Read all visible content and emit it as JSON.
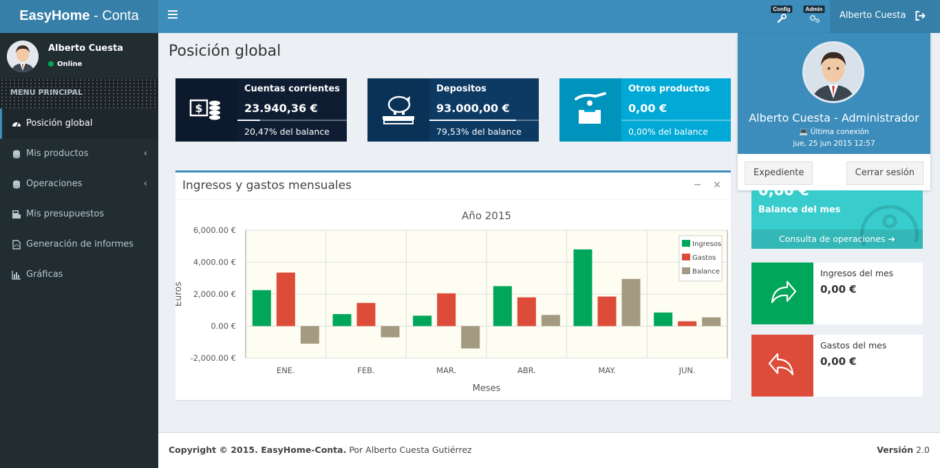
{
  "header": {
    "logo_bold": "EasyHome",
    "logo_rest": " - Conta",
    "config_label": "Config",
    "admin_label": "Admin",
    "user_name": "Alberto Cuesta"
  },
  "sidebar": {
    "user_name": "Alberto Cuesta",
    "status": "Online",
    "menu_header": "MENU PRINCIPAL",
    "items": [
      {
        "label": "Posición global",
        "icon": "dashboard-icon"
      },
      {
        "label": "Mis productos",
        "icon": "coins-icon"
      },
      {
        "label": "Operaciones",
        "icon": "coins-icon"
      },
      {
        "label": "Mis presupuestos",
        "icon": "calculator-icon"
      },
      {
        "label": "Generación de informes",
        "icon": "file-pdf-icon"
      },
      {
        "label": "Gráficas",
        "icon": "bar-chart-icon"
      }
    ]
  },
  "main": {
    "title": "Posición global",
    "info_boxes": [
      {
        "title": "Cuentas corrientes",
        "value": "23.940,36 €",
        "desc": "20,47% del balance",
        "progress": 0.2047,
        "color": "#0f1d33",
        "icon": "money-coins-icon"
      },
      {
        "title": "Depositos",
        "value": "93.000,00 €",
        "desc": "79,53% del balance",
        "progress": 0.7953,
        "color": "#0c3a63",
        "icon": "piggy-bank-icon"
      },
      {
        "title": "Otros productos",
        "value": "0,00 €",
        "desc": "0,00% del balance",
        "progress": 0.0,
        "color": "#00a9d6",
        "icon": "hand-coin-icon"
      }
    ]
  },
  "chart_panel": {
    "title": "Ingresos y gastos mensuales",
    "minimize": "−",
    "close": "×"
  },
  "chart_data": {
    "type": "bar",
    "title": "Año 2015",
    "xlabel": "Meses",
    "ylabel": "Euros",
    "categories": [
      "ENE.",
      "FEB.",
      "MAR.",
      "ABR.",
      "MAY.",
      "JUN."
    ],
    "ylim": [
      -2000,
      6000
    ],
    "yticks": [
      6000,
      4000,
      2000,
      0,
      -2000
    ],
    "ytick_labels": [
      "6,000.00 €",
      "4,000.00 €",
      "2,000.00 €",
      "0.00 €",
      "-2,000.00 €"
    ],
    "grid": true,
    "legend_position": "top-right",
    "series": [
      {
        "name": "Ingresos",
        "color": "#00a65a",
        "values": [
          2250,
          750,
          650,
          2500,
          4800,
          850
        ]
      },
      {
        "name": "Gastos",
        "color": "#dd4b39",
        "values": [
          3350,
          1450,
          2050,
          1800,
          1850,
          300
        ]
      },
      {
        "name": "Balance",
        "color": "#a39a81",
        "values": [
          -1100,
          -700,
          -1400,
          700,
          2950,
          550
        ]
      }
    ]
  },
  "profile": {
    "name": "Alberto Cuesta - Administrador",
    "last_label": "Última conexión",
    "last_date": "jue, 25 jun 2015 12:57",
    "btn_file": "Expediente",
    "btn_logout": "Cerrar sesión"
  },
  "month_box": {
    "value": "0,00 €",
    "label": "Balance del mes",
    "link": "Consulta de operaciones"
  },
  "income_box": {
    "title": "Ingresos del mes",
    "value": "0,00 €",
    "color": "#00a65a"
  },
  "expense_box": {
    "title": "Gastos del mes",
    "value": "0,00 €",
    "color": "#dd4b39"
  },
  "footer": {
    "copyright": "Copyright © 2015. EasyHome-Conta.",
    "author": " Por Alberto Cuesta Gutiérrez",
    "version_label": "Versión",
    "version": " 2.0"
  }
}
